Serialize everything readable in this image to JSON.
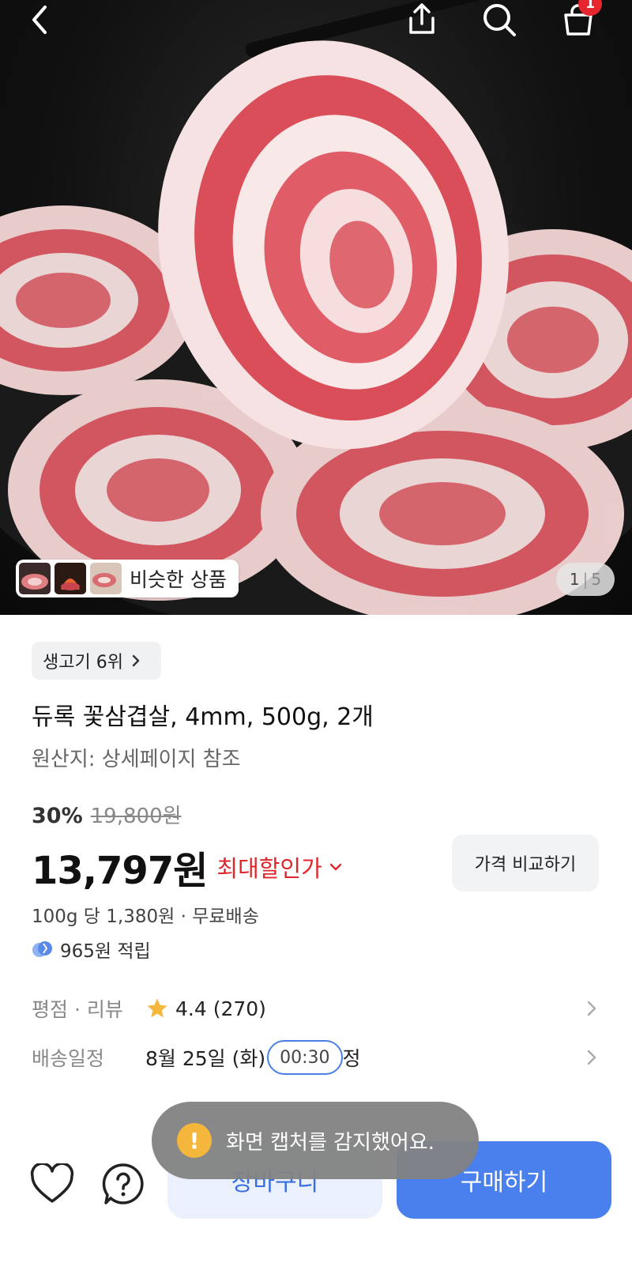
{
  "topbar": {
    "cart_count": "1"
  },
  "hero": {
    "similar_label": "비슷한 상품",
    "page_current": "1",
    "page_separator": "|",
    "page_total": "5"
  },
  "product": {
    "rank_label": "생고기 6위",
    "title": "듀록 꽃삼겹살, 4mm, 500g, 2개",
    "origin": "원산지: 상세페이지 참조",
    "discount_rate": "30%",
    "original_price": "19,800원",
    "price": "13,797원",
    "max_discount_label": "최대할인가",
    "compare_label": "가격 비교하기",
    "unit_price": "100g 당 1,380원 · 무료배송",
    "reward": "965원 적립"
  },
  "info": {
    "rating_label": "평점 · 리뷰",
    "rating_value": "4.4 (270)",
    "delivery_label": "배송일정",
    "delivery_date": "8월 25일 (화)",
    "delivery_time": "00:30",
    "delivery_suffix": "정"
  },
  "bottom": {
    "cart_button": "장바구니",
    "buy_button": "구매하기"
  },
  "toast": {
    "icon": "!",
    "message": "화면 캡처를 감지했어요."
  },
  "colors": {
    "accent_blue": "#4a80ee",
    "discount_red": "#e0262b",
    "badge_red": "#e6262e",
    "toast_bg": "#828282",
    "toast_icon": "#f5b73b",
    "star": "#f5b73b"
  },
  "icons": {
    "back": "back-arrow-icon",
    "share": "share-icon",
    "search": "search-icon",
    "cart": "cart-icon",
    "heart": "heart-icon",
    "question": "question-icon",
    "star": "star-icon",
    "reward": "reward-coin-icon",
    "chevron": "chevron-right-icon"
  }
}
